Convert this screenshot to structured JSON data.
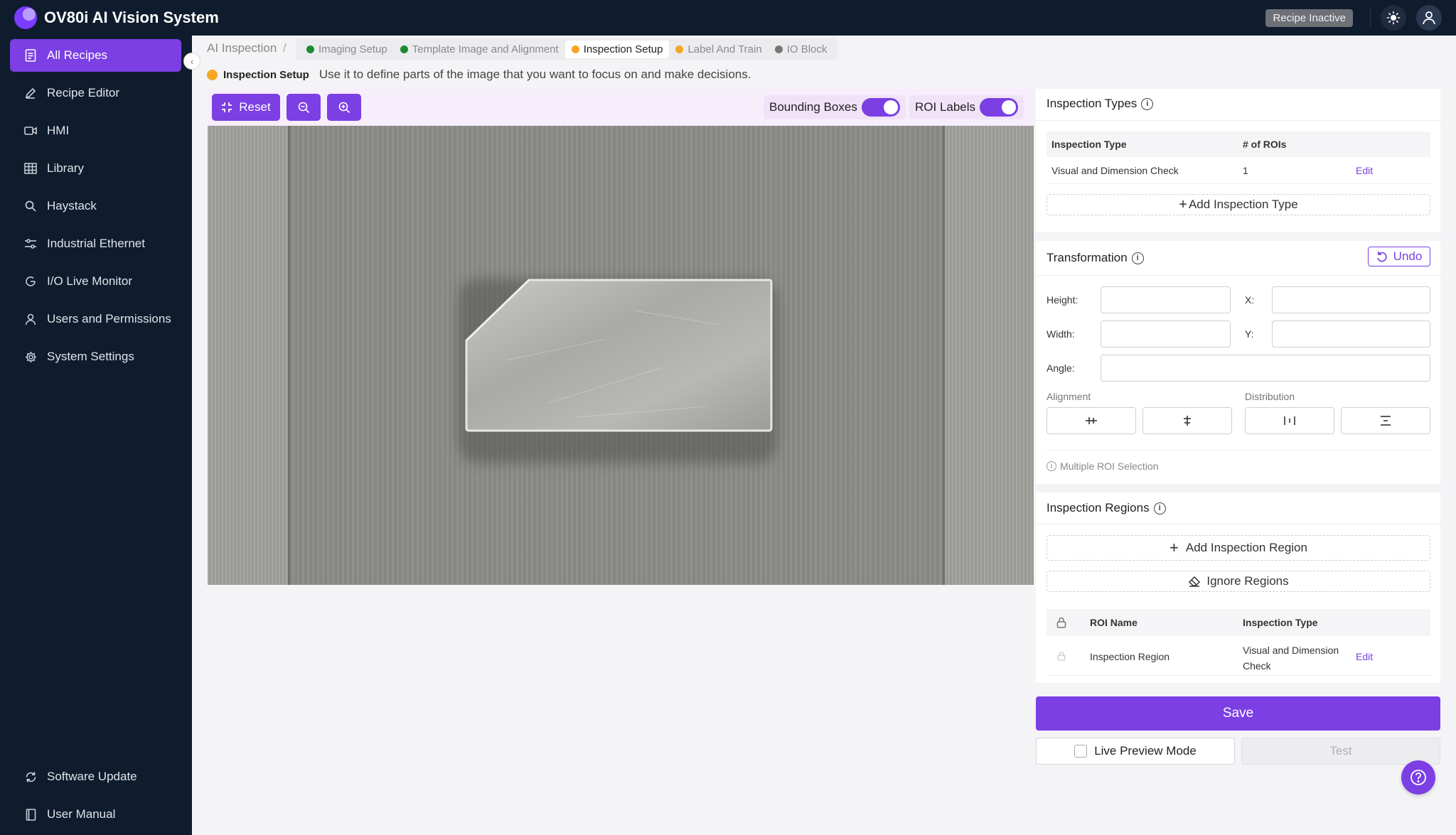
{
  "app": {
    "title": "OV80i AI Vision System",
    "recipe_status": "Recipe Inactive"
  },
  "sidebar": {
    "items": [
      {
        "label": "All Recipes",
        "icon": "document-icon",
        "active": true
      },
      {
        "label": "Recipe Editor",
        "icon": "pencil-icon"
      },
      {
        "label": "HMI",
        "icon": "video-icon"
      },
      {
        "label": "Library",
        "icon": "grid-icon"
      },
      {
        "label": "Haystack",
        "icon": "search-icon"
      },
      {
        "label": "Industrial Ethernet",
        "icon": "network-icon"
      },
      {
        "label": "I/O Live Monitor",
        "icon": "monitor-icon"
      },
      {
        "label": "Users and Permissions",
        "icon": "user-icon"
      },
      {
        "label": "System Settings",
        "icon": "gear-icon"
      }
    ],
    "bottom_items": [
      {
        "label": "Software Update",
        "icon": "refresh-icon"
      },
      {
        "label": "User Manual",
        "icon": "book-icon"
      }
    ]
  },
  "breadcrumb": {
    "root": "AI Inspection",
    "separator": "/",
    "tabs": [
      {
        "label": "Imaging Setup",
        "status_color": "#1e8a2e"
      },
      {
        "label": "Template Image and Alignment",
        "status_color": "#1e8a2e"
      },
      {
        "label": "Inspection Setup",
        "status_color": "#f5a623",
        "active": true
      },
      {
        "label": "Label And Train",
        "status_color": "#f5a623"
      },
      {
        "label": "IO Block",
        "status_color": "#777777"
      }
    ]
  },
  "step": {
    "name": "Inspection Setup",
    "description": "Use it to define parts of the image that you want to focus on and make decisions."
  },
  "viewer": {
    "reset_label": "Reset",
    "bounding_boxes_label": "Bounding Boxes",
    "bounding_boxes_on": true,
    "roi_labels_label": "ROI Labels",
    "roi_labels_on": true
  },
  "inspection_types": {
    "title": "Inspection Types",
    "col_type": "Inspection Type",
    "col_rois": "# of ROIs",
    "rows": [
      {
        "type": "Visual and Dimension Check",
        "rois": "1",
        "action": "Edit"
      }
    ],
    "add_label": "Add Inspection Type"
  },
  "transformation": {
    "title": "Transformation",
    "undo_label": "Undo",
    "height_label": "Height:",
    "width_label": "Width:",
    "x_label": "X:",
    "y_label": "Y:",
    "angle_label": "Angle:",
    "alignment_label": "Alignment",
    "distribution_label": "Distribution",
    "multi_roi_label": "Multiple ROI Selection"
  },
  "inspection_regions": {
    "title": "Inspection Regions",
    "add_region_label": "Add Inspection Region",
    "ignore_regions_label": "Ignore Regions",
    "col_name": "ROI Name",
    "col_type": "Inspection Type",
    "rows": [
      {
        "name": "Inspection Region",
        "type_line1": "Visual and Dimension",
        "type_line2": "Check",
        "action": "Edit"
      }
    ]
  },
  "actions": {
    "save_label": "Save",
    "live_preview_label": "Live Preview Mode",
    "test_label": "Test"
  }
}
